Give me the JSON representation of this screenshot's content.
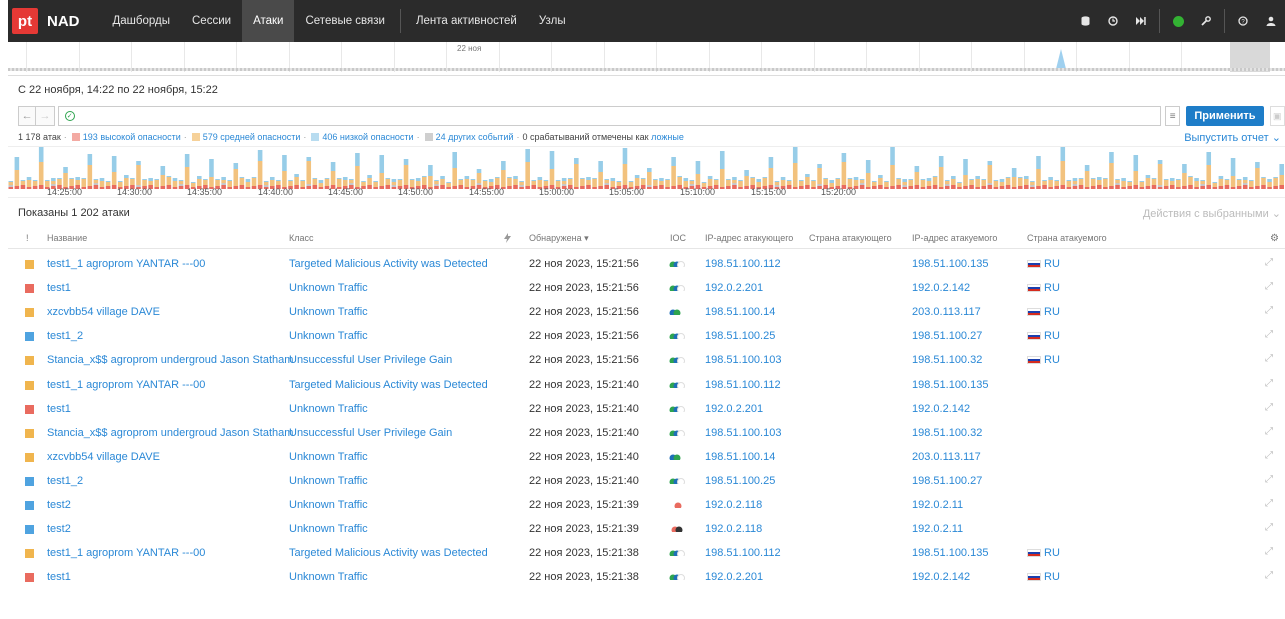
{
  "nav": {
    "logo": "pt",
    "brand": "NAD",
    "items": [
      "Дашборды",
      "Сессии",
      "Атаки",
      "Сетевые связи",
      "Лента активностей",
      "Узлы"
    ],
    "active": "Атаки"
  },
  "timeline": {
    "day_label": "22 ноя"
  },
  "period": "С 22 ноября, 14:22 по 22 ноября, 15:22",
  "filter": {
    "query": "",
    "apply_label": "Применить"
  },
  "summary": {
    "total": "1 178 атак",
    "high": "193 высокой опасности",
    "medium": "579 средней опасности",
    "low": "406 низкой опасности",
    "other": "24 других событий",
    "false_text": "0 срабатываний отмечены как",
    "false_link": "ложные"
  },
  "report_label": "Выпустить отчет",
  "colors": {
    "high": "#e96b5f",
    "medium": "#f2c27e",
    "low": "#97cde8",
    "other": "#c7c7c7",
    "accent": "#1e7dc8"
  },
  "histogram_ticks": [
    "14:25:00",
    "14:30:00",
    "14:35:00",
    "14:40:00",
    "14:45:00",
    "14:50:00",
    "14:55:00",
    "15:00:00",
    "15:05:00",
    "15:10:00",
    "15:15:00",
    "15:20:00"
  ],
  "shown": "Показаны 1 202 атаки",
  "actions": "Действия с выбранными",
  "columns": {
    "sev": "!",
    "name": "Название",
    "class": "Класс",
    "detected": "Обнаружена",
    "ioc": "IOC",
    "src_ip": "IP-адрес атакующего",
    "src_country": "Страна атакующего",
    "dst_ip": "IP-адрес атакуемого",
    "dst_country": "Страна атакуемого"
  },
  "rows": [
    {
      "sev": "medium",
      "name": "test1_1 agroprom YANTAR ---00",
      "class": "Targeted Malicious Activity was Detected",
      "detected": "22 ноя 2023, 15:21:56",
      "ioc": "gb",
      "src": "198.51.100.112",
      "dst": "198.51.100.135",
      "country": "RU"
    },
    {
      "sev": "high",
      "name": "test1",
      "class": "Unknown Traffic",
      "detected": "22 ноя 2023, 15:21:56",
      "ioc": "gb",
      "src": "192.0.2.201",
      "dst": "192.0.2.142",
      "country": "RU"
    },
    {
      "sev": "medium",
      "name": "xzcvbb54 village DAVE",
      "class": "Unknown Traffic",
      "detected": "22 ноя 2023, 15:21:56",
      "ioc": "b",
      "src": "198.51.100.14",
      "dst": "203.0.113.117",
      "country": "RU"
    },
    {
      "sev": "low",
      "name": "test1_2",
      "class": "Unknown Traffic",
      "detected": "22 ноя 2023, 15:21:56",
      "ioc": "gb",
      "src": "198.51.100.25",
      "dst": "198.51.100.27",
      "country": "RU"
    },
    {
      "sev": "medium",
      "name": "Stancia_x$$ agroprom undergroud Jason Statham",
      "class": "Unsuccessful User Privilege Gain",
      "detected": "22 ноя 2023, 15:21:56",
      "ioc": "gb",
      "src": "198.51.100.103",
      "dst": "198.51.100.32",
      "country": "RU"
    },
    {
      "sev": "medium",
      "name": "test1_1 agroprom YANTAR ---00",
      "class": "Targeted Malicious Activity was Detected",
      "detected": "22 ноя 2023, 15:21:40",
      "ioc": "gb",
      "src": "198.51.100.112",
      "dst": "198.51.100.135",
      "country": ""
    },
    {
      "sev": "high",
      "name": "test1",
      "class": "Unknown Traffic",
      "detected": "22 ноя 2023, 15:21:40",
      "ioc": "gb",
      "src": "192.0.2.201",
      "dst": "192.0.2.142",
      "country": ""
    },
    {
      "sev": "medium",
      "name": "Stancia_x$$ agroprom undergroud Jason Statham",
      "class": "Unsuccessful User Privilege Gain",
      "detected": "22 ноя 2023, 15:21:40",
      "ioc": "gb",
      "src": "198.51.100.103",
      "dst": "198.51.100.32",
      "country": ""
    },
    {
      "sev": "medium",
      "name": "xzcvbb54 village DAVE",
      "class": "Unknown Traffic",
      "detected": "22 ноя 2023, 15:21:40",
      "ioc": "b",
      "src": "198.51.100.14",
      "dst": "203.0.113.117",
      "country": ""
    },
    {
      "sev": "low",
      "name": "test1_2",
      "class": "Unknown Traffic",
      "detected": "22 ноя 2023, 15:21:40",
      "ioc": "gb",
      "src": "198.51.100.25",
      "dst": "198.51.100.27",
      "country": ""
    },
    {
      "sev": "low",
      "name": "test2",
      "class": "Unknown Traffic",
      "detected": "22 ноя 2023, 15:21:39",
      "ioc": "r",
      "src": "192.0.2.118",
      "dst": "192.0.2.11",
      "country": ""
    },
    {
      "sev": "low",
      "name": "test2",
      "class": "Unknown Traffic",
      "detected": "22 ноя 2023, 15:21:39",
      "ioc": "rk",
      "src": "192.0.2.118",
      "dst": "192.0.2.11",
      "country": ""
    },
    {
      "sev": "medium",
      "name": "test1_1 agroprom YANTAR ---00",
      "class": "Targeted Malicious Activity was Detected",
      "detected": "22 ноя 2023, 15:21:38",
      "ioc": "gb",
      "src": "198.51.100.112",
      "dst": "198.51.100.135",
      "country": "RU"
    },
    {
      "sev": "high",
      "name": "test1",
      "class": "Unknown Traffic",
      "detected": "22 ноя 2023, 15:21:38",
      "ioc": "gb",
      "src": "192.0.2.201",
      "dst": "192.0.2.142",
      "country": "RU"
    }
  ]
}
